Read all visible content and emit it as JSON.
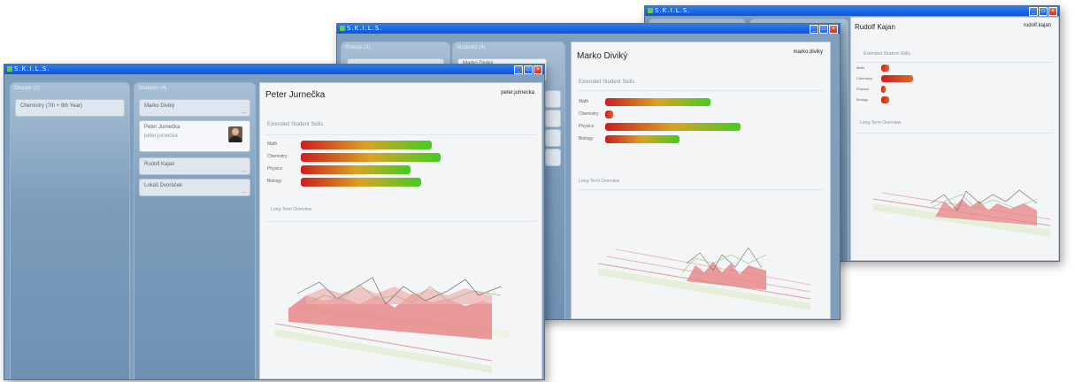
{
  "app": {
    "title": "S.K.I.L.S."
  },
  "window_controls": {
    "minimize": "_",
    "maximize": "□",
    "close": "×"
  },
  "front": {
    "groups_header": "Groups (1)",
    "group_item": "Chemistry (7th + 8th Year)",
    "students_header": "Students (4)",
    "students": [
      {
        "name": "Marko Diviký",
        "sub": ""
      },
      {
        "name": "Peter Jurnečka",
        "sub": "peter.jurnecka"
      },
      {
        "name": "Rudolf Kajan",
        "sub": ""
      },
      {
        "name": "Lukáš Dvoráček",
        "sub": ""
      }
    ],
    "more": "...",
    "detail": {
      "name": "Peter Jurnečka",
      "username": "peter.jurnecka",
      "skills_title": "Extended Student Skills",
      "skills": [
        {
          "label": "Math",
          "value": 0.87
        },
        {
          "label": "Chemistry",
          "value": 0.93
        },
        {
          "label": "Physics",
          "value": 0.73
        },
        {
          "label": "Biology",
          "value": 0.8
        }
      ],
      "overview_title": "Long-Term Overview"
    }
  },
  "middle": {
    "groups_header": "Groups (1)",
    "students_header": "Students (4)",
    "selected_student": "Marko Diviký",
    "detail": {
      "name": "Marko Diviký",
      "username": "marko.diviky",
      "skills_title": "Extended Student Skills",
      "skills": [
        {
          "label": "Math",
          "value": 0.75
        },
        {
          "label": "Chemistry",
          "value": 0.06
        },
        {
          "label": "Physics",
          "value": 0.97
        },
        {
          "label": "Biology",
          "value": 0.53
        }
      ],
      "overview_title": "Long-Term Overview"
    }
  },
  "back": {
    "detail": {
      "name": "Rudolf Kajan",
      "username": "rudolf.kajan",
      "skills_title": "Extended Student Skills",
      "skills": [
        {
          "label": "Math",
          "value": 0.1
        },
        {
          "label": "Chemistry",
          "value": 0.4
        },
        {
          "label": "Physics",
          "value": 0.06
        },
        {
          "label": "Biology",
          "value": 0.1
        }
      ],
      "overview_title": "Long-Term Overview"
    }
  },
  "colors": {
    "bar_start": "#cc1f1f",
    "bar_end": "#44cc22",
    "titlebar": "#0a56d8"
  }
}
